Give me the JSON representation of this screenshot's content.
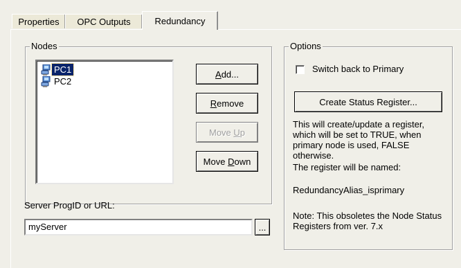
{
  "tabs": [
    {
      "label": "Properties"
    },
    {
      "label": "OPC Outputs"
    },
    {
      "label": "Redundancy"
    }
  ],
  "nodes": {
    "title": "Nodes",
    "items": [
      {
        "label": "PC1",
        "selected": true
      },
      {
        "label": "PC2",
        "selected": false
      }
    ],
    "buttons": {
      "add": {
        "pre": "",
        "u": "A",
        "post": "dd..."
      },
      "remove": {
        "pre": "",
        "u": "R",
        "post": "emove"
      },
      "move_up": {
        "pre": "Move ",
        "u": "U",
        "post": "p"
      },
      "move_down": {
        "pre": "Move ",
        "u": "D",
        "post": "own"
      }
    }
  },
  "server": {
    "label": "Server ProgID or URL:",
    "value": "myServer",
    "browse_label": "..."
  },
  "options": {
    "title": "Options",
    "switch_back_label": "Switch back to Primary",
    "switch_back_checked": false,
    "create_register_label": "Create Status Register...",
    "desc1": "This will create/update a register, which will be set to TRUE, when primary node is used, FALSE otherwise.",
    "desc2": "The register will be named:",
    "register_name": "RedundancyAlias_isprimary",
    "note": "Note: This obsoletes the Node Status Registers from ver. 7.x"
  },
  "colors": {
    "selection": "#0a246a",
    "face": "#f0efe8"
  }
}
